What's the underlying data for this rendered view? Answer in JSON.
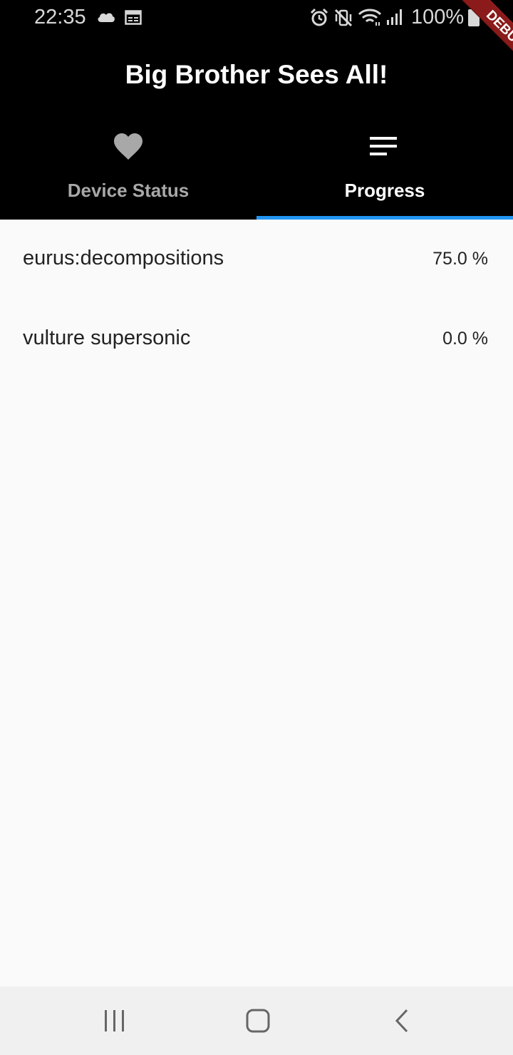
{
  "status_bar": {
    "time": "22:35",
    "battery": "100%",
    "icons": [
      "cloud-icon",
      "calendar-icon",
      "alarm-icon",
      "vibrate-off-icon",
      "wifi-icon",
      "signal-icon",
      "battery-icon"
    ]
  },
  "app_bar": {
    "title": "Big Brother Sees All!",
    "tabs": [
      {
        "label": "Device Status",
        "icon": "heart-icon",
        "selected": false
      },
      {
        "label": "Progress",
        "icon": "sort-lines-icon",
        "selected": true
      }
    ],
    "indicator_color": "#2196f3"
  },
  "debug_banner": {
    "label": "DEBUG"
  },
  "progress_list": {
    "items": [
      {
        "name": "eurus:decompositions",
        "value": "75.0 %"
      },
      {
        "name": "vulture supersonic",
        "value": "0.0 %"
      }
    ]
  },
  "nav_bar": {
    "buttons": [
      "recents-icon",
      "home-icon",
      "back-icon"
    ]
  },
  "colors": {
    "app_bar_bg": "#000000",
    "background": "#fafafa",
    "debug_ribbon": "#8b1a1a"
  }
}
